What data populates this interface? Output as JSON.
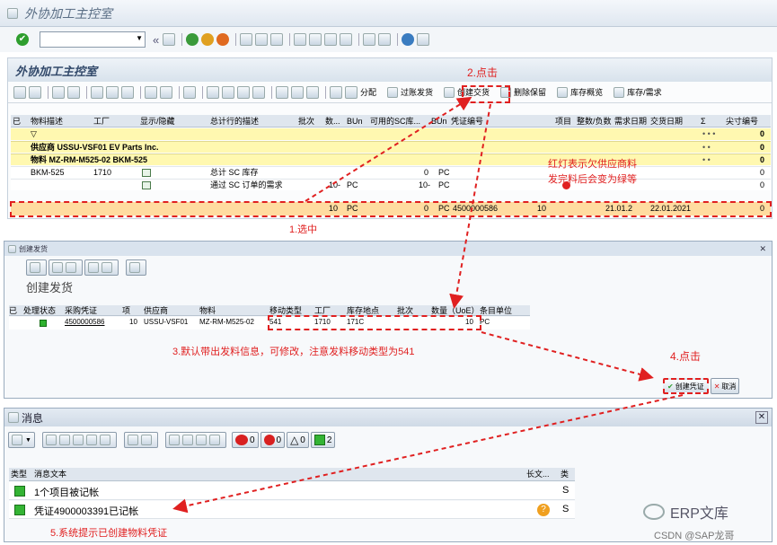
{
  "window": {
    "title": "外协加工主控室"
  },
  "std_toolbar": {
    "command_field": "",
    "back": "«"
  },
  "panel": {
    "title": "外协加工主控室"
  },
  "app_toolbar": {
    "fenpei": "分配",
    "guozhang": "过账发货",
    "create_delivery": "创建交货",
    "delete_reserve": "删除保留",
    "stock_overview": "库存概览",
    "stock_demand": "库存/需求"
  },
  "grid": {
    "columns": [
      "已",
      "物料描述",
      "工厂",
      "显示/隐藏",
      "总计行的描述",
      "批次",
      "数...",
      "BUn",
      "可用的SC库...",
      "BUn",
      "凭证编号",
      "项目",
      "整数/负数",
      "需求日期",
      "交货日期",
      "Σ",
      "尖寸编号"
    ],
    "filter_row": {
      "dots": "• • •",
      "value": "0"
    },
    "supplier_row": {
      "label": "供应商 USSU-VSF01 EV Parts Inc.",
      "value": "0",
      "dots": "• •"
    },
    "material_row": {
      "label": "物料 MZ-RM-M525-02 BKM-525",
      "value": "0",
      "dots": "• •"
    },
    "row1": {
      "material": "BKM-525",
      "plant": "1710",
      "desc": "总计 SC 库存",
      "avail": "0",
      "bun": "PC",
      "value": "0"
    },
    "row2": {
      "desc": "通过 SC 订单的需求",
      "qty": "10-",
      "bun1": "PC",
      "avail": "10-",
      "bun2": "PC",
      "value": "0"
    },
    "row3": {
      "qty": "10",
      "bun1": "PC",
      "avail": "0",
      "bun2": "PC",
      "doc": "4500000586",
      "item": "10",
      "req_date": "21.01.2",
      "del_date": "22.01.2021",
      "value": "0"
    }
  },
  "annotations": {
    "a1": "1.选中",
    "a2": "2.点击",
    "a3": "3.默认带出发料信息，可修改，注意发料移动类型为541",
    "a4": "4.点击",
    "a5": "5.系统提示已创建物料凭证",
    "note_line1": "红灯表示欠供应商料",
    "note_line2": "发完料后会变为绿等"
  },
  "dialog_create": {
    "title": "创建发货",
    "heading": "创建发货",
    "columns": [
      "已",
      "处理状态",
      "采购凭证",
      "项",
      "供应商",
      "物料",
      "移动类型",
      "工厂",
      "库存地点",
      "批次",
      "数量（UoE）",
      "条目单位"
    ],
    "row": {
      "po": "4500000586",
      "item": "10",
      "vendor": "USSU-VSF01",
      "material": "MZ-RM-M525-02",
      "mvt": "541",
      "plant": "1710",
      "sloc": "171C",
      "batch": "",
      "qty": "10",
      "unit": "PC"
    },
    "create_btn": "创建凭证",
    "cancel_btn": "取消"
  },
  "dialog_msg": {
    "title": "消息",
    "counts": {
      "error": "0",
      "stop": "0",
      "warning": "0",
      "success": "2"
    },
    "columns": [
      "类型",
      "消息文本",
      "长文...",
      "类"
    ],
    "rows": [
      {
        "text": "1个项目被记帐",
        "class": "S"
      },
      {
        "text": "凭证4900003391已记帐",
        "class": "S"
      }
    ]
  },
  "watermark": {
    "brand": "ERP文库",
    "credit": "CSDN @SAP龙哥"
  },
  "colors": {
    "yellow_row": "#fff8b0",
    "selected_row": "#ffdca0",
    "annotation_red": "#e02020",
    "title_blue": "#334a6b"
  }
}
